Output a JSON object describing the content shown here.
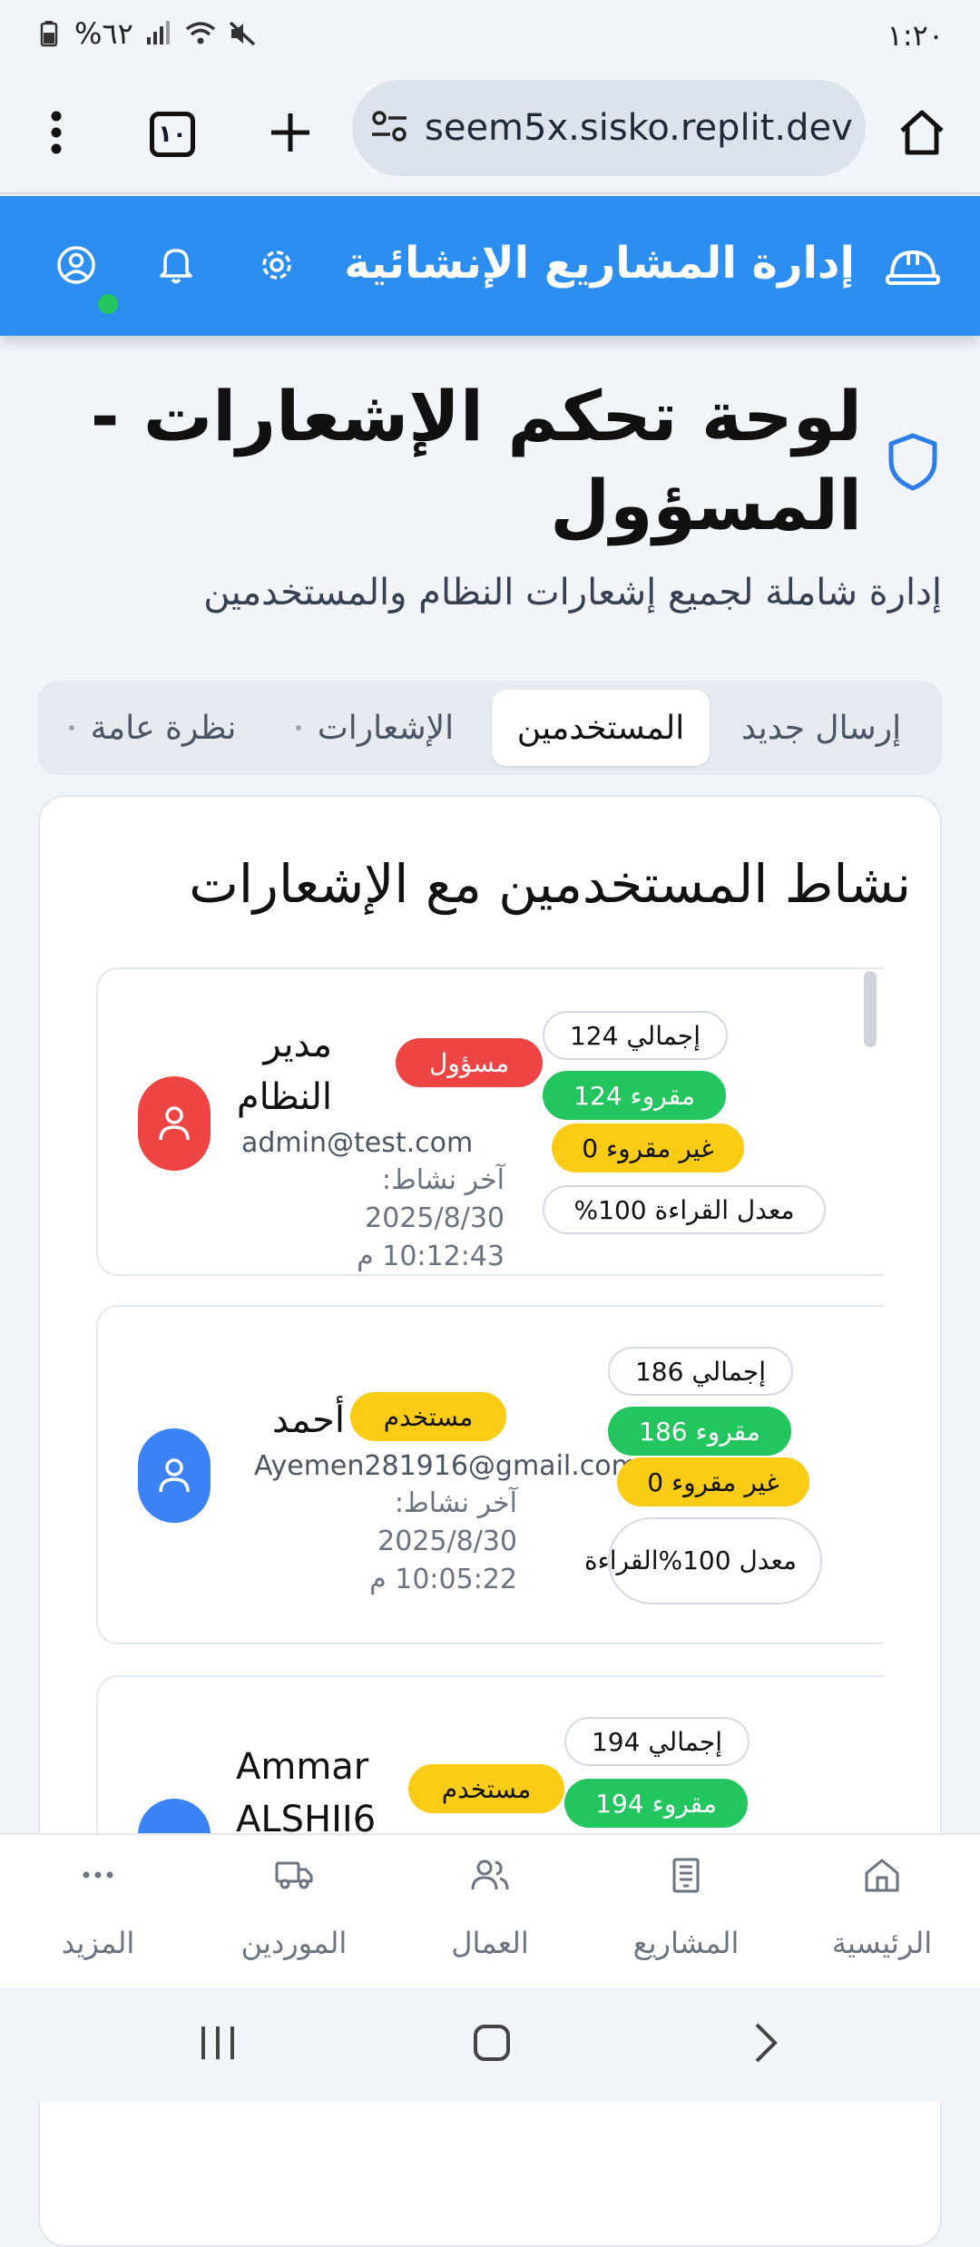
{
  "status_bar": {
    "time": "١:٢٠",
    "battery": "%٦٢"
  },
  "browser": {
    "url": "seem5x.sisko.replit.dev",
    "tab_count": "١٠"
  },
  "header": {
    "title": "إدارة المشاريع الإنشائية"
  },
  "page": {
    "title_line1": "لوحة تحكم الإشعارات -",
    "title_line2": "المسؤول",
    "subtitle": "إدارة شاملة لجميع إشعارات النظام والمستخدمين"
  },
  "tabs": [
    {
      "label": "إرسال جديد"
    },
    {
      "label": "المستخدمين",
      "active": true
    },
    {
      "label": "الإشعارات"
    },
    {
      "label": "نظرة عامة"
    }
  ],
  "activity": {
    "title": "نشاط المستخدمين مع الإشعارات",
    "users": [
      {
        "name_line1": "مدير",
        "name_line2": "النظام",
        "role": "مسؤول",
        "email": "admin@test.com",
        "last_active_line1": "آخر نشاط: 2025/8/30",
        "last_active_line2": "10:12:43 م",
        "total": "إجمالي 124",
        "read": "مقروء 124",
        "unread": "غير مقروء 0",
        "rate": "معدل القراءة 100%"
      },
      {
        "name_line1": "أحمد",
        "role": "مستخدم",
        "email": "Ayemen281916@gmail.com",
        "last_active_line1": "آخر نشاط: 2025/8/30",
        "last_active_line2": "10:05:22 م",
        "total": "إجمالي 186",
        "read": "مقروء 186",
        "unread": "غير مقروء 0",
        "rate_line1": "معدل 100%",
        "rate_line2": "القراءة"
      },
      {
        "name_line1": "Ammar",
        "name_line2": "ALSHII6",
        "role": "مستخدم",
        "total": "إجمالي 194",
        "read": "مقروء 194"
      }
    ]
  },
  "bottom_nav": [
    {
      "label": "المزيد",
      "icon": "more-icon"
    },
    {
      "label": "الموردين",
      "icon": "truck-icon"
    },
    {
      "label": "العمال",
      "icon": "users-icon"
    },
    {
      "label": "المشاريع",
      "icon": "building-icon"
    },
    {
      "label": "الرئيسية",
      "icon": "home-icon"
    }
  ],
  "colors": {
    "header": "#2b8ef0",
    "admin_badge": "#ef4444",
    "user_badge": "#facc15",
    "read_pill": "#22c55e",
    "online": "#22c55e"
  }
}
